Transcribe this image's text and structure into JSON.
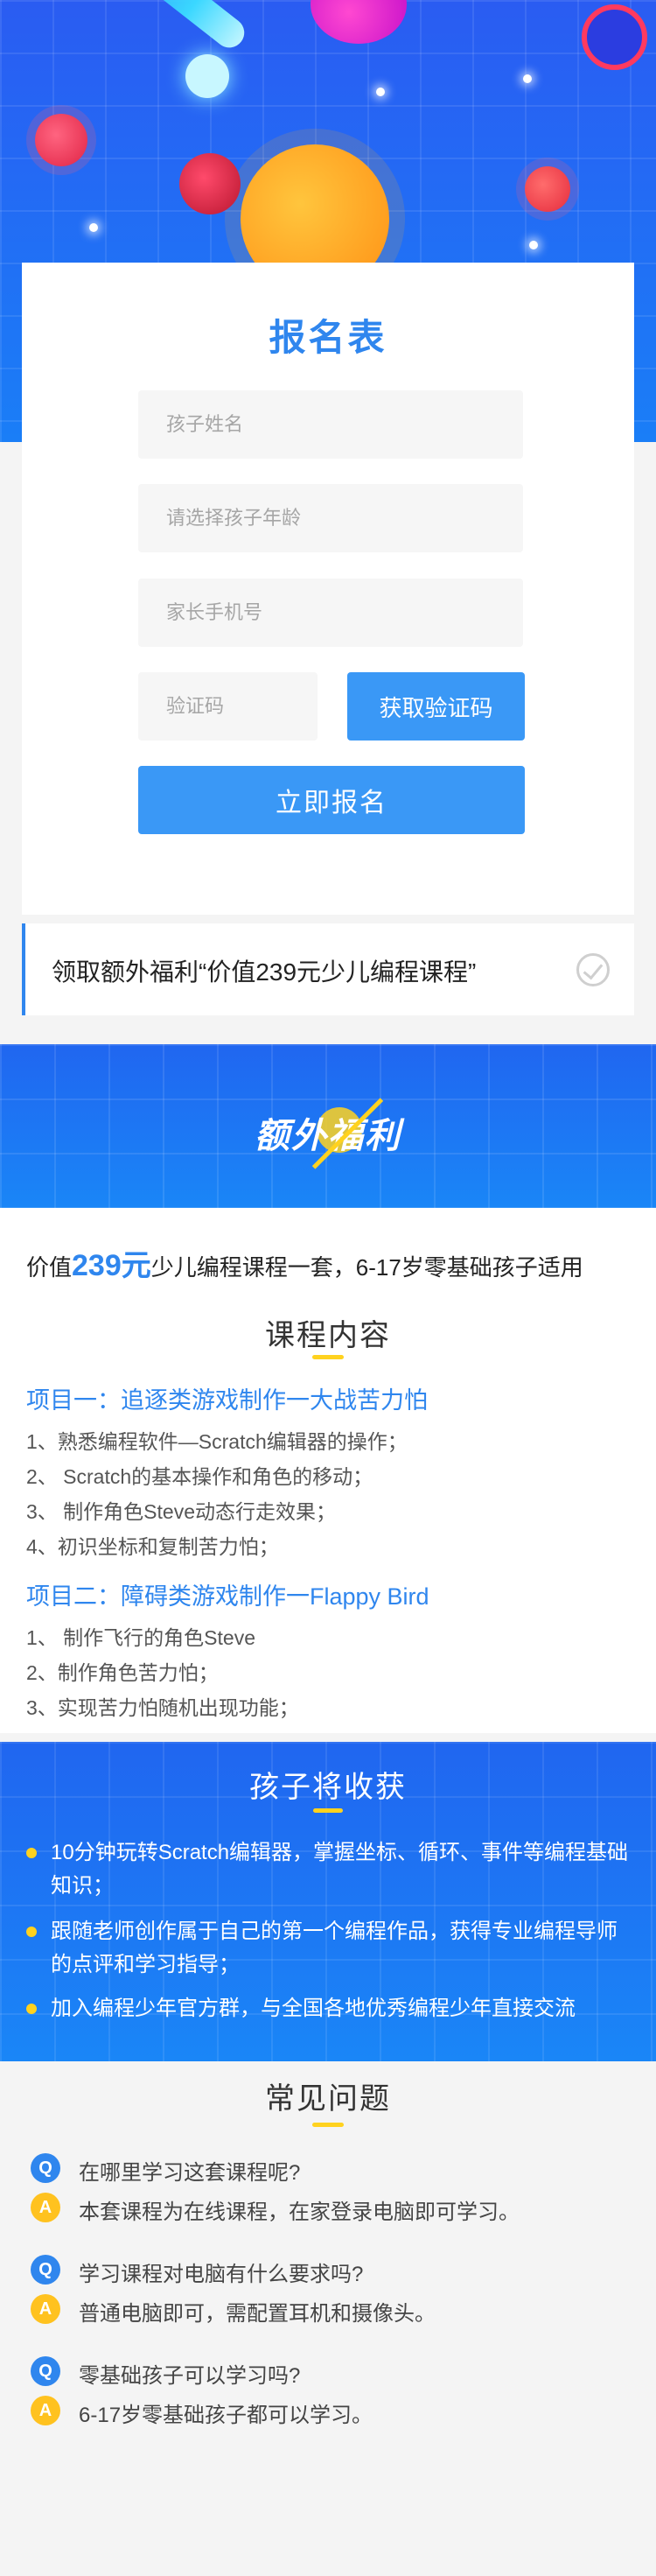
{
  "form": {
    "title": "报名表",
    "child_name_placeholder": "孩子姓名",
    "child_age_placeholder": "请选择孩子年龄",
    "parent_phone_placeholder": "家长手机号",
    "code_placeholder": "验证码",
    "get_code_label": "获取验证码",
    "submit_label": "立即报名"
  },
  "bonus": {
    "text": "领取额外福利“价值239元少儿编程课程”"
  },
  "banner": {
    "title": "额外福利"
  },
  "intro": {
    "prefix": "价值",
    "price": "239元",
    "suffix": "少儿编程课程一套，6-17岁零基础孩子适用"
  },
  "course": {
    "title": "课程内容",
    "project1": {
      "title": "项目一：追逐类游戏制作一大战苦力怕",
      "items": [
        "1、熟悉编程软件—Scratch编辑器的操作；",
        "2、 Scratch的基本操作和角色的移动；",
        "3、 制作角色Steve动态行走效果；",
        "4、初识坐标和复制苦力怕；"
      ]
    },
    "project2": {
      "title": "项目二：障碍类游戏制作一Flappy Bird",
      "items": [
        "1、 制作飞行的角色Steve",
        "2、制作角色苦力怕；",
        "3、实现苦力怕随机出现功能；"
      ]
    }
  },
  "gains": {
    "title": "孩子将收获",
    "items": [
      "10分钟玩转Scratch编辑器，掌握坐标、循环、事件等编程基础知识；",
      "跟随老师创作属于自己的第一个编程作品，获得专业编程导师的点评和学习指导；",
      "加入编程少年官方群，与全国各地优秀编程少年直接交流"
    ]
  },
  "faq": {
    "title": "常见问题",
    "q_mark": "Q",
    "a_mark": "A",
    "items": [
      {
        "q": "在哪里学习这套课程呢?",
        "a": "本套课程为在线课程，在家登录电脑即可学习。"
      },
      {
        "q": "学习课程对电脑有什么要求吗?",
        "a": "普通电脑即可，需配置耳机和摄像头。"
      },
      {
        "q": "零基础孩子可以学习吗?",
        "a": "6-17岁零基础孩子都可以学习。"
      }
    ]
  },
  "colors": {
    "accent_blue": "#2f86ee",
    "button_blue": "#3a98f6",
    "accent_yellow": "#ffd21f"
  }
}
